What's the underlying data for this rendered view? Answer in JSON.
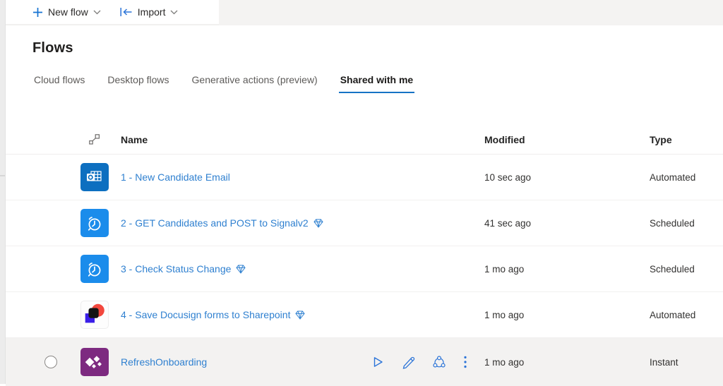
{
  "toolbar": {
    "new_flow_label": "New flow",
    "import_label": "Import"
  },
  "page_title": "Flows",
  "tabs": [
    {
      "label": "Cloud flows",
      "active": false
    },
    {
      "label": "Desktop flows",
      "active": false
    },
    {
      "label": "Generative actions (preview)",
      "active": false
    },
    {
      "label": "Shared with me",
      "active": true
    }
  ],
  "table": {
    "headers": {
      "name": "Name",
      "modified": "Modified",
      "type": "Type"
    },
    "rows": [
      {
        "name": "1 - New Candidate Email",
        "modified": "10 sec ago",
        "type": "Automated",
        "icon": "outlook",
        "premium": false,
        "highlighted": false
      },
      {
        "name": "2 - GET Candidates and POST to Signalv2",
        "modified": "41 sec ago",
        "type": "Scheduled",
        "icon": "recurrence",
        "premium": true,
        "highlighted": false
      },
      {
        "name": "3 - Check Status Change",
        "modified": "1 mo ago",
        "type": "Scheduled",
        "icon": "recurrence",
        "premium": true,
        "highlighted": false
      },
      {
        "name": "4 - Save Docusign forms to Sharepoint",
        "modified": "1 mo ago",
        "type": "Automated",
        "icon": "docusign",
        "premium": true,
        "highlighted": false
      },
      {
        "name": "RefreshOnboarding",
        "modified": "1 mo ago",
        "type": "Instant",
        "icon": "connector",
        "premium": false,
        "highlighted": true
      }
    ]
  },
  "colors": {
    "accent_blue": "#1673c5",
    "link_blue": "#2f80d0",
    "action_icon_blue": "#2b74d8",
    "tile_recurrence_blue": "#1b8ceb",
    "tile_outlook_blue": "#0d6fc0",
    "tile_connector_purple": "#7d2a80",
    "hover_row_bg": "#f3f2f1",
    "topbar_gray": "#f4f3f2"
  }
}
